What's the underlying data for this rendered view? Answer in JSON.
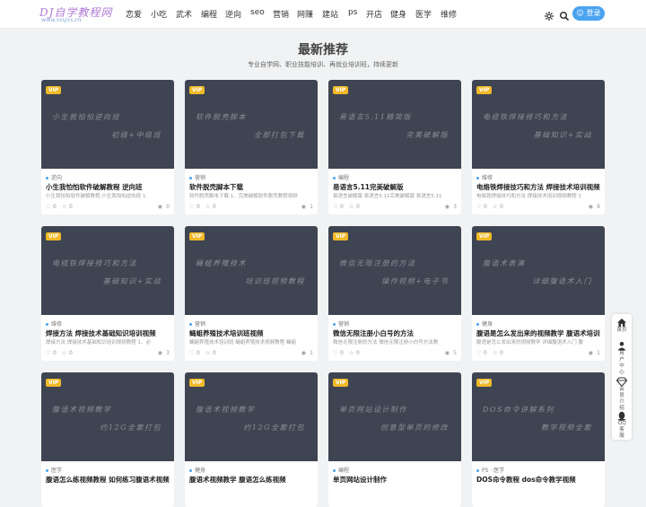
{
  "header": {
    "logo_text": "DJ自学教程网",
    "logo_sub": "www.xxxjxx.cn",
    "nav": [
      "恋爱",
      "小吃",
      "武术",
      "编程",
      "逆向",
      "seo",
      "营销",
      "网赚",
      "建站",
      "ps",
      "开店",
      "健身",
      "医学",
      "维修"
    ],
    "login_label": "登录"
  },
  "main": {
    "title": "最新推荐",
    "subtitle": "专业自学网、职业技能培训、再就业培训班，持续更新"
  },
  "cards": [
    {
      "vip": "VIP",
      "thumb_line1": "小生我怕怕逆向班",
      "thumb_line2": "初级+中级班",
      "category": "逆向",
      "title": "小生我怕怕软件破解教程 逆向班",
      "desc": "小生我怕怕软件破解教程,小生我怕怕逆向班 1.",
      "likes": "0",
      "stars": "0",
      "views": "0"
    },
    {
      "vip": "VIP",
      "thumb_line1": "软件脱壳脚本",
      "thumb_line2": "全部打包下载",
      "category": "营销",
      "title": "软件脱壳脚本下载",
      "desc": "软件脱壳脚本下载 1、完美破解软件脱壳教程视频",
      "likes": "0",
      "stars": "0",
      "views": "1"
    },
    {
      "vip": "VIP",
      "thumb_line1": "易语言5.11精简版",
      "thumb_line2": "完美破解版",
      "category": "编程",
      "title": "易语言5.11完美破解版",
      "desc": "易语言破解版 易语言5.11完美破解版 易语言5.11",
      "likes": "0",
      "stars": "0",
      "views": "3"
    },
    {
      "vip": "VIP",
      "thumb_line1": "电缆铁焊接技巧和方法",
      "thumb_line2": "基础知识+实战",
      "category": "维修",
      "title": "电烙铁焊接技巧和方法 焊接技术培训视频",
      "desc": "电烙铁焊接技巧和方法 焊接技术培训视频教程 1",
      "likes": "0",
      "stars": "0",
      "views": "8"
    },
    {
      "vip": "VIP",
      "thumb_line1": "电缆铁焊接技巧和方法",
      "thumb_line2": "基础知识+实战",
      "category": "维修",
      "title": "焊接方法 焊接技术基础知识培训视频",
      "desc": "焊接方法 焊接技术基础知识培训视频教程 1、必",
      "likes": "0",
      "stars": "0",
      "views": "3"
    },
    {
      "vip": "VIP",
      "thumb_line1": "蝇蛆养殖技术",
      "thumb_line2": "培训班视频教程",
      "category": "营销",
      "title": "蝇蛆养殖技术培训班视频",
      "desc": "蝇蛆养殖技术培训班 蝇蛆养殖技术视频教程 蝇蛆",
      "likes": "0",
      "stars": "0",
      "views": "1"
    },
    {
      "vip": "VIP",
      "thumb_line1": "微信无限注册的方法",
      "thumb_line2": "操作视频+电子书",
      "category": "营销",
      "title": "微信无限注册小白号的方法",
      "desc": "微信无限注册的方法 微信无限注册小白号方法教",
      "likes": "0",
      "stars": "0",
      "views": "5"
    },
    {
      "vip": "VIP",
      "thumb_line1": "腹语术表演",
      "thumb_line2": "详细腹语术入门",
      "category": "健身",
      "title": "腹语是怎么发出来的视频教学 腹语术培训",
      "desc": "腹语是怎么发出来的视频教学 详细腹语术入门 腹",
      "likes": "0",
      "stars": "0",
      "views": "1"
    },
    {
      "vip": "VIP",
      "thumb_line1": "腹语术视频教学",
      "thumb_line2": "约12G全套打包",
      "category": "医学",
      "title": "腹语怎么练视频教程 如何练习腹语术视频",
      "desc": "",
      "likes": "",
      "stars": "",
      "views": ""
    },
    {
      "vip": "VIP",
      "thumb_line1": "腹语术视频教学",
      "thumb_line2": "约12G全套打包",
      "category": "健身",
      "title": "腹语术视频教学 腹语怎么练视频",
      "desc": "",
      "likes": "",
      "stars": "",
      "views": ""
    },
    {
      "vip": "VIP",
      "thumb_line1": "单页网站设计制作",
      "thumb_line2": "创意型单页的修改",
      "category": "编程",
      "title": "单页网站设计制作",
      "desc": "",
      "likes": "",
      "stars": "",
      "views": ""
    },
    {
      "vip": "VIP",
      "thumb_line1": "DOS命令讲解系列",
      "thumb_line2": "教学视频全套",
      "category": "PS · 医学",
      "title": "DOS命令教程 dos命令教学视频",
      "desc": "",
      "likes": "",
      "stars": "",
      "views": ""
    }
  ],
  "sidebar": [
    {
      "label": "首页",
      "icon": "home-icon"
    },
    {
      "label": "用户中心",
      "icon": "user-icon"
    },
    {
      "label": "会员介绍",
      "icon": "diamond-icon"
    },
    {
      "label": "QQ客服",
      "icon": "qq-icon"
    }
  ]
}
